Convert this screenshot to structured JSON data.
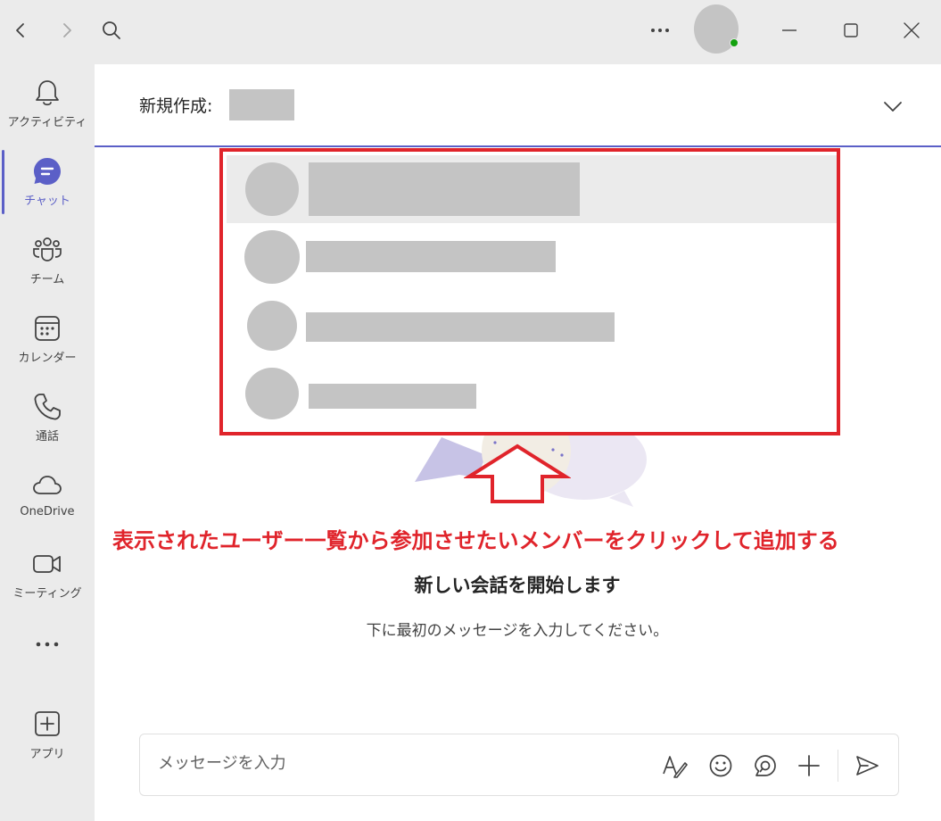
{
  "titlebar": {
    "back": "back-icon",
    "forward": "forward-icon",
    "search": "search-icon",
    "more": "more-icon",
    "minimize": "minimize-icon",
    "maximize": "maximize-icon",
    "close": "close-icon"
  },
  "rail": {
    "items": [
      {
        "label": "アクティビティ",
        "icon": "bell-icon"
      },
      {
        "label": "チャット",
        "icon": "chat-icon",
        "active": true
      },
      {
        "label": "チーム",
        "icon": "teams-icon"
      },
      {
        "label": "カレンダー",
        "icon": "calendar-icon"
      },
      {
        "label": "通話",
        "icon": "phone-icon"
      },
      {
        "label": "OneDrive",
        "icon": "cloud-icon"
      },
      {
        "label": "ミーティング",
        "icon": "video-icon"
      },
      {
        "label": "",
        "icon": "more-icon"
      },
      {
        "label": "アプリ",
        "icon": "add-app-icon"
      }
    ]
  },
  "new_chat": {
    "to_label": "新規作成:"
  },
  "annotation": {
    "text": "表示されたユーザー一覧から参加させたいメンバーをクリックして追加する",
    "color": "#e0242b"
  },
  "empty_state": {
    "title": "新しい会話を開始します",
    "subtitle": "下に最初のメッセージを入力してください。"
  },
  "composer": {
    "placeholder": "メッセージを入力"
  },
  "colors": {
    "accent": "#5b5fc7",
    "annotation": "#e0242b",
    "rail_bg": "#ebebeb",
    "redaction": "#c4c4c4"
  }
}
